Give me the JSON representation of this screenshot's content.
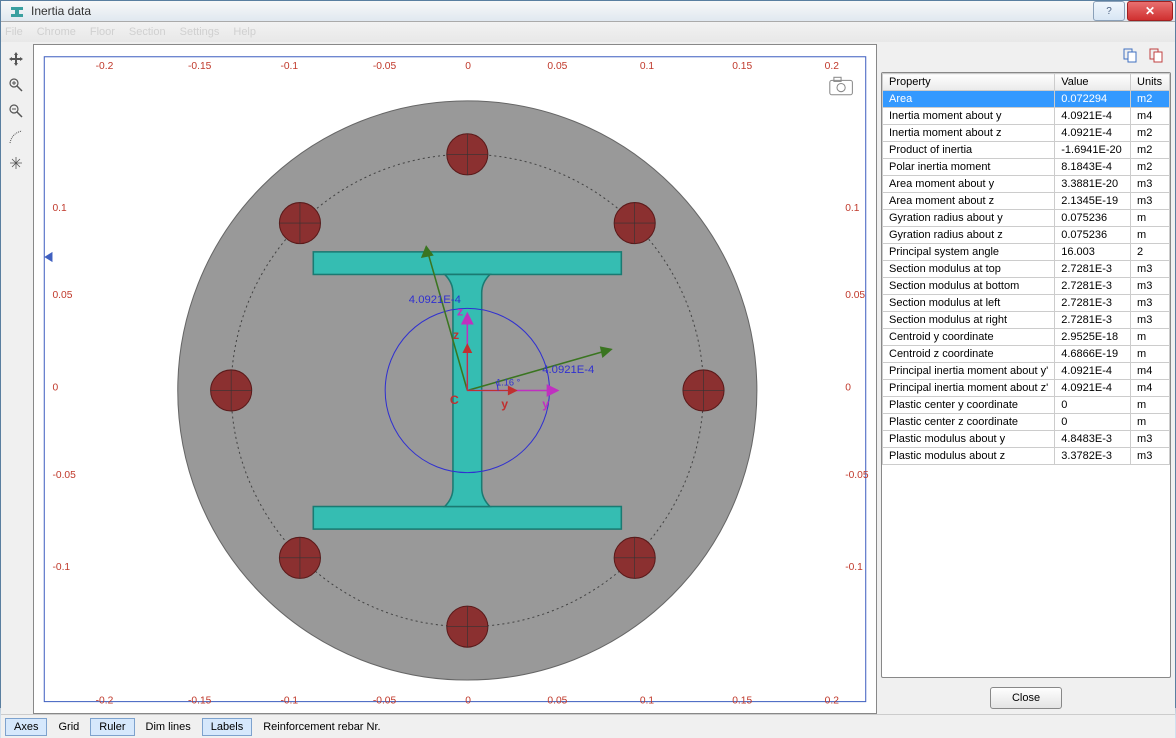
{
  "window": {
    "title": "Inertia data"
  },
  "menu": {
    "items": [
      "File",
      "Chrome",
      "Floor",
      "Section",
      "Settings",
      "Help"
    ]
  },
  "ruler": {
    "ticks": [
      "-0.2",
      "-0.15",
      "-0.1",
      "-0.05",
      "0",
      "0.05",
      "0.1",
      "0.15",
      "0.2"
    ],
    "yticks": [
      "0.1",
      "0.05",
      "0",
      "-0.05",
      "-0.1"
    ]
  },
  "canvas": {
    "inertia_text1": "4.0921E-4",
    "inertia_text2": "4.0921E-4",
    "angle_text": "1.16 °",
    "y_label": "y",
    "z_label": "z",
    "c_label": "C"
  },
  "table": {
    "headers": [
      "Property",
      "Value",
      "Units"
    ],
    "rows": [
      {
        "p": "Area",
        "v": "0.072294",
        "u": "m2",
        "sel": true
      },
      {
        "p": "Inertia moment about y",
        "v": "4.0921E-4",
        "u": "m4"
      },
      {
        "p": "Inertia moment about z",
        "v": "4.0921E-4",
        "u": "m2"
      },
      {
        "p": "Product of inertia",
        "v": "-1.6941E-20",
        "u": "m2"
      },
      {
        "p": "Polar inertia moment",
        "v": "8.1843E-4",
        "u": "m2"
      },
      {
        "p": "Area moment about y",
        "v": "3.3881E-20",
        "u": "m3"
      },
      {
        "p": "Area moment about z",
        "v": "2.1345E-19",
        "u": "m3"
      },
      {
        "p": "Gyration radius about y",
        "v": "0.075236",
        "u": "m"
      },
      {
        "p": "Gyration radius about z",
        "v": "0.075236",
        "u": "m"
      },
      {
        "p": "Principal system angle",
        "v": "16.003",
        "u": "2"
      },
      {
        "p": "Section modulus at top",
        "v": "2.7281E-3",
        "u": "m3"
      },
      {
        "p": "Section modulus at bottom",
        "v": "2.7281E-3",
        "u": "m3"
      },
      {
        "p": "Section modulus at left",
        "v": "2.7281E-3",
        "u": "m3"
      },
      {
        "p": "Section modulus at right",
        "v": "2.7281E-3",
        "u": "m3"
      },
      {
        "p": "Centroid y coordinate",
        "v": "2.9525E-18",
        "u": "m"
      },
      {
        "p": "Centroid z coordinate",
        "v": "4.6866E-19",
        "u": "m"
      },
      {
        "p": "Principal inertia moment about y'",
        "v": "4.0921E-4",
        "u": "m4"
      },
      {
        "p": "Principal inertia moment about z'",
        "v": "4.0921E-4",
        "u": "m4"
      },
      {
        "p": "Plastic center y coordinate",
        "v": "0",
        "u": "m"
      },
      {
        "p": "Plastic center z coordinate",
        "v": "0",
        "u": "m"
      },
      {
        "p": "Plastic modulus about y",
        "v": "4.8483E-3",
        "u": "m3"
      },
      {
        "p": "Plastic modulus about z",
        "v": "3.3782E-3",
        "u": "m3"
      }
    ]
  },
  "buttons": {
    "close": "Close"
  },
  "bottom": {
    "items": [
      {
        "label": "Axes",
        "active": true
      },
      {
        "label": "Grid",
        "active": false
      },
      {
        "label": "Ruler",
        "active": true
      },
      {
        "label": "Dim lines",
        "active": false
      },
      {
        "label": "Labels",
        "active": true
      },
      {
        "label": "Reinforcement rebar Nr.",
        "active": false
      }
    ]
  }
}
